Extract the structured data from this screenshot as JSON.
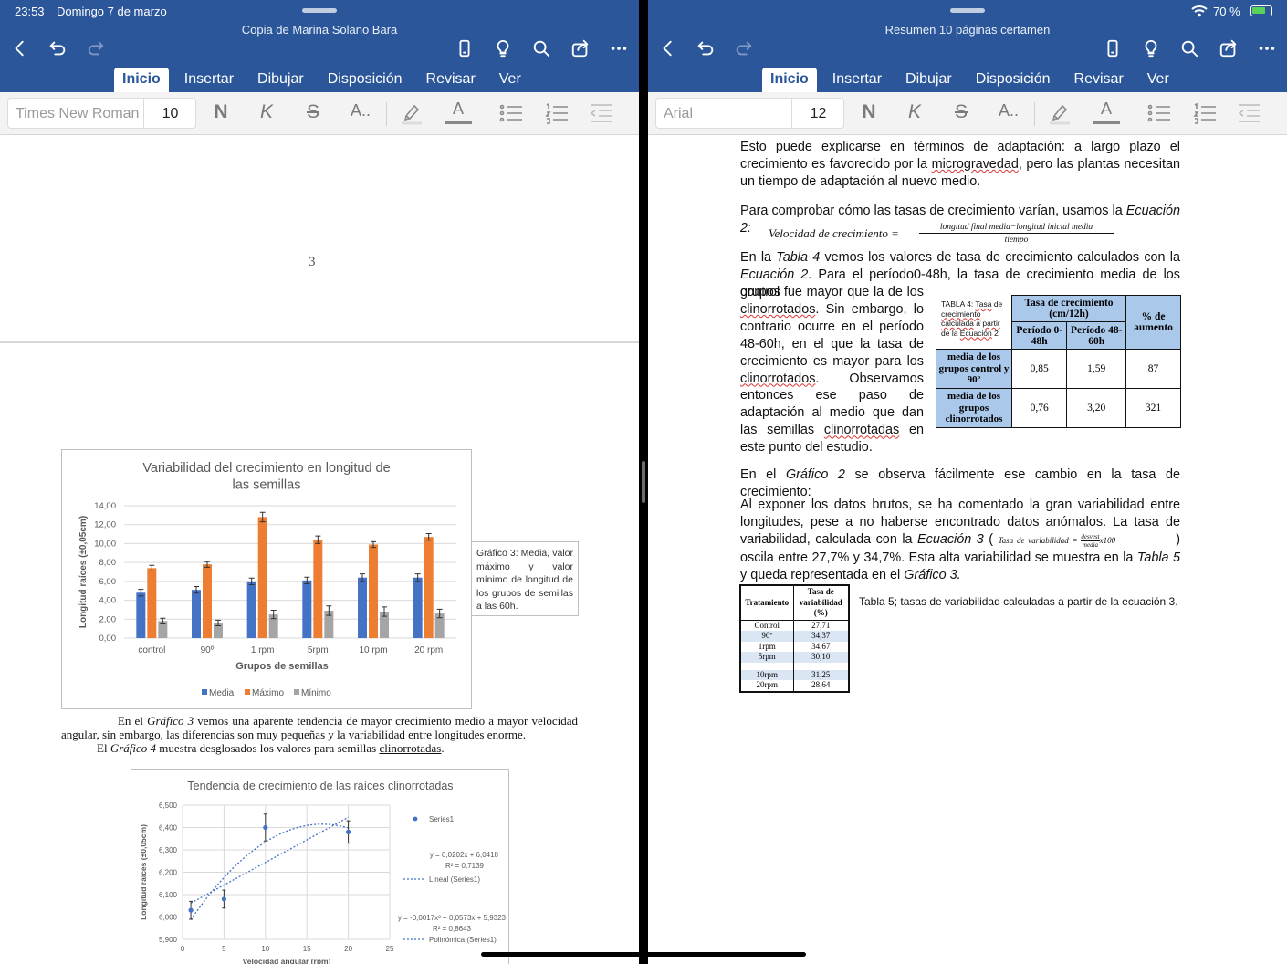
{
  "status": {
    "time": "23:53",
    "date": "Domingo 7 de marzo",
    "battery": "70 %"
  },
  "left": {
    "doc_title": "Copia de Marina Solano Bara",
    "tabs": [
      "Inicio",
      "Insertar",
      "Dibujar",
      "Disposición",
      "Revisar",
      "Ver"
    ],
    "font_name": "Times New Roman",
    "font_size": "10",
    "format_labels": {
      "bold": "N",
      "italic": "K",
      "strike": "S",
      "style": "A..",
      "color": "A"
    },
    "page_number": "3",
    "chart1_caption": "Gráfico 3: Media, valor máximo y valor mínimo de longitud de los grupos de semillas a las 60h.",
    "para1_html": "&nbsp;&nbsp;&nbsp;&nbsp;&nbsp;&nbsp;&nbsp;&nbsp;&nbsp;&nbsp;&nbsp;&nbsp;&nbsp;&nbsp;&nbsp;En el <i>Gráfico 3</i> vemos una aparente tendencia de mayor crecimiento medio a mayor velocidad angular, sin embargo, las diferencias son muy pequeñas y la variabilidad entre longitudes enorme.",
    "para2_html": "&nbsp;&nbsp;&nbsp;&nbsp;&nbsp;&nbsp;&nbsp;&nbsp;&nbsp;&nbsp;&nbsp;&nbsp;El <i>Gráfico 4</i> muestra desglosados los valores para semillas <span style=\"text-decoration:underline\">clinorrotadas</span>."
  },
  "right": {
    "doc_title": "Resumen 10 páginas certamen",
    "tabs": [
      "Inicio",
      "Insertar",
      "Dibujar",
      "Disposición",
      "Revisar",
      "Ver"
    ],
    "font_name": "Arial",
    "font_size": "12",
    "p1_html": "Esto puede explicarse en términos de adaptación: a largo plazo el crecimiento es favorecido por la <span class=\"sq\">microgravedad</span>, pero las plantas necesitan un tiempo de adaptación al nuevo medio.",
    "p2_html": "Para comprobar cómo las tasas de crecimiento varían, usamos la <i>Ecuación 2:</i>",
    "equation2_lhs": "Velocidad de crecimiento =",
    "equation2_num": "longitud final media−longitud inicial media",
    "equation2_den": "tiempo",
    "p3a_html": "En la <i>Tabla 4</i> vemos los valores de tasa de crecimiento calculados con la <i>Ecuación 2</i>. Para el período0-48h, la tasa de crecimiento media de los grupos",
    "p3b_html": "control fue mayor que la de los <span class=\"sq\">clinorrotados</span>. Sin embargo, lo contrario ocurre en el período 48-60h, en el que la tasa de crecimiento es mayor para los <span class=\"sq\">clinorrotados</span>. Observamos entonces ese paso de adaptación al medio que dan las semillas <span class=\"sq\">clinorrotadas</span> en este punto del estudio.",
    "table4_caption_html": "TABLA 4: <span class=\"sq\">Tasa</span> de <span class=\"sq\">crecimiento calculada</span> a <span class=\"sq\">partir</span> de la <span class=\"sq\">Ecuación</span> 2",
    "table4": {
      "h_rate": "Tasa de crecimiento (cm/12h)",
      "h_increase": "% de aumento",
      "h_p1": "Período 0-48h",
      "h_p2": "Período 48-60h",
      "rows": [
        {
          "label": "media de los grupos control y 90º",
          "p1": "0,85",
          "p2": "1,59",
          "inc": "87"
        },
        {
          "label": "media de los grupos clinorrotados",
          "p1": "0,76",
          "p2": "3,20",
          "inc": "321"
        }
      ]
    },
    "p4_html": "En el <i>Gráfico 2</i> se observa fácilmente ese cambio en la tasa de crecimiento:",
    "p5_html": "Al exponer los datos brutos, se ha comentado la gran variabilidad entre longitudes, pese a no haberse encontrado datos anómalos. La tasa de variabilidad, calculada con la <i>Ecuación 3</i> ( <span class=\"eq\" style=\"font-size:9px\">Tasa de variabilidad = <span style=\"display:inline-block;vertical-align:middle;text-align:center;font-size:7px;line-height:8px\"><span style=\"display:block;border-bottom:1px solid #111\">desvest</span><span style=\"display:block\">media</span></span>x100</span> &nbsp;&nbsp;&nbsp;&nbsp;&nbsp;&nbsp;&nbsp;&nbsp;&nbsp;&nbsp;&nbsp;) oscila entre 27,7% y 34,7%. Esta alta variabilidad se muestra en la <i>Tabla 5</i> y queda representada en el <i>Gráfico 3.</i>",
    "table5": {
      "h_treatment": "Tratamiento",
      "h_rate": "Tasa de variabilidad (%)",
      "rows": [
        {
          "t": "Control",
          "v": "27,71"
        },
        {
          "t": "90º",
          "v": "34,37"
        },
        {
          "t": "1rpm",
          "v": "34,67"
        },
        {
          "t": "5rpm",
          "v": "30,10"
        },
        {
          "t": "",
          "v": ""
        },
        {
          "t": "10rpm",
          "v": "31,25"
        },
        {
          "t": "20rpm",
          "v": "28,64"
        }
      ]
    },
    "table5_caption": "Tabla 5; tasas de variabilidad calculadas a partir de la ecuación 3."
  },
  "chart_data": [
    {
      "type": "bar",
      "title": "Variabilidad del crecimiento en longitud de las semillas",
      "xlabel": "Grupos de semillas",
      "ylabel": "Longitud raíces (±0,05cm)",
      "ylim": [
        0,
        14
      ],
      "yticks": [
        "0,00",
        "2,00",
        "4,00",
        "6,00",
        "8,00",
        "10,00",
        "12,00",
        "14,00"
      ],
      "categories": [
        "control",
        "90º",
        "1 rpm",
        "5rpm",
        "10 rpm",
        "20 rpm"
      ],
      "series": [
        {
          "name": "Media",
          "color": "#4472c4",
          "values": [
            4.8,
            5.1,
            6.0,
            6.1,
            6.4,
            6.4
          ],
          "errors": [
            0.35,
            0.35,
            0.35,
            0.35,
            0.4,
            0.4
          ]
        },
        {
          "name": "Máximo",
          "color": "#ed7d31",
          "values": [
            7.4,
            7.8,
            12.8,
            10.4,
            9.9,
            10.7
          ],
          "errors": [
            0.3,
            0.3,
            0.5,
            0.4,
            0.3,
            0.35
          ]
        },
        {
          "name": "Mínimo",
          "color": "#a5a5a5",
          "values": [
            1.8,
            1.6,
            2.5,
            2.9,
            2.8,
            2.6
          ],
          "errors": [
            0.3,
            0.3,
            0.45,
            0.5,
            0.5,
            0.45
          ]
        }
      ],
      "legend": "bottom",
      "grid": true
    },
    {
      "type": "scatter",
      "title": "Tendencia de crecimiento de las raíces clinorrotadas",
      "xlabel": "Velocidad angular (rpm)",
      "ylabel": "Longitud raíces (±0,05cm)",
      "xlim": [
        0,
        25
      ],
      "ylim": [
        5.9,
        6.5
      ],
      "xticks": [
        "0",
        "5",
        "10",
        "15",
        "20",
        "25"
      ],
      "yticks": [
        "5,900",
        "6,000",
        "6,100",
        "6,200",
        "6,300",
        "6,400",
        "6,500"
      ],
      "series": [
        {
          "name": "Series1",
          "color": "#4472c4",
          "x": [
            1,
            5,
            10,
            20
          ],
          "y": [
            6.03,
            6.08,
            6.4,
            6.38
          ],
          "errors": [
            0.04,
            0.04,
            0.06,
            0.05
          ]
        }
      ],
      "trendlines": [
        {
          "name": "Lineal (Series1)",
          "equation": "y = 0,0202x + 6,0418",
          "r2": "R² = 0,7139"
        },
        {
          "name": "Polinómica (Series1)",
          "equation": "y = -0,0017x² + 0,0573x + 5,9323",
          "r2": "R² = 0,8643"
        }
      ],
      "legend": "right",
      "grid": true
    }
  ]
}
